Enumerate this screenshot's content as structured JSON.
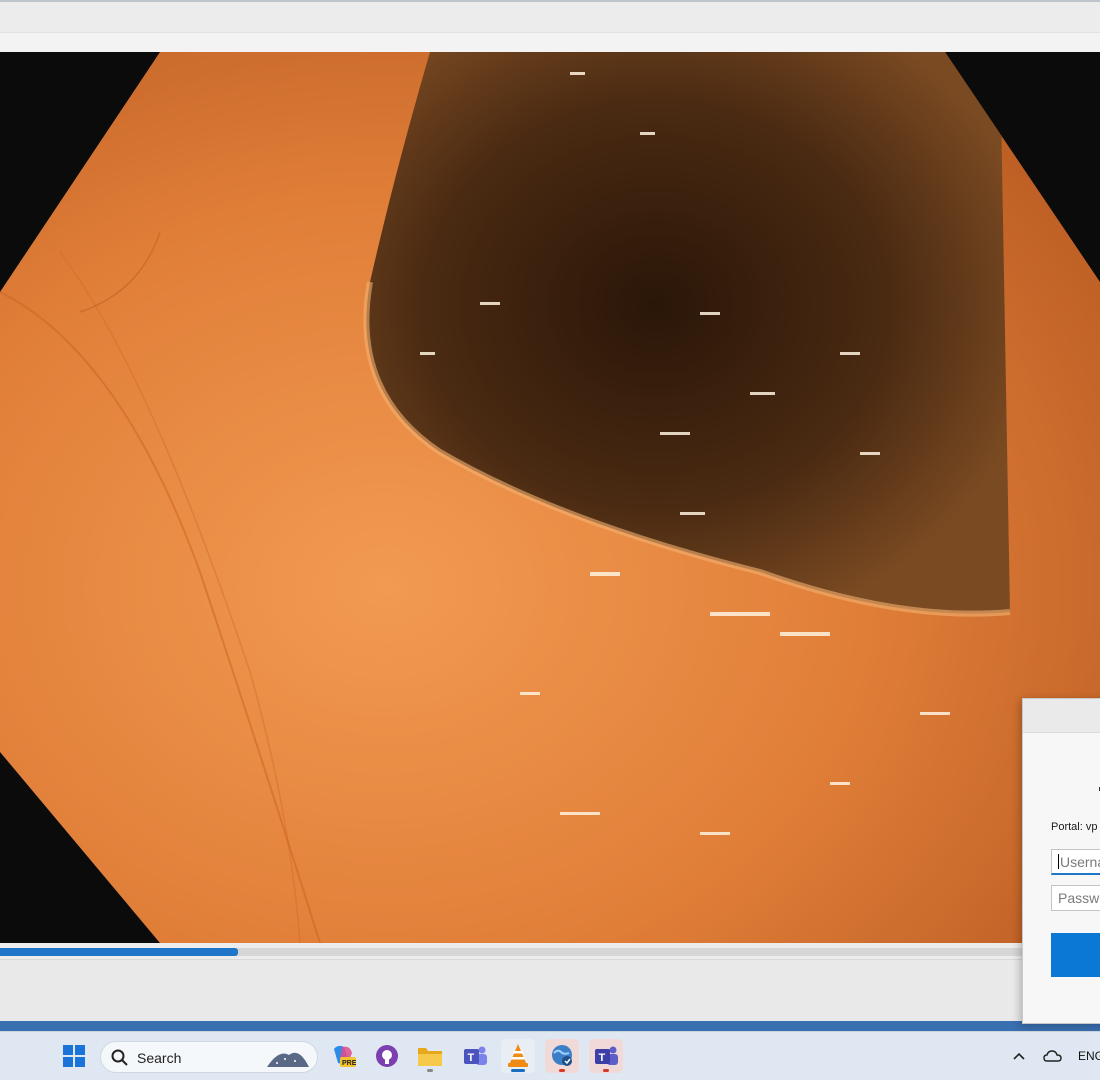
{
  "player": {
    "progress_fraction": 0.216
  },
  "vpn_dialog": {
    "portal_label": "Portal: vp",
    "username_placeholder": "Userna",
    "password_placeholder": "Passwo"
  },
  "taskbar": {
    "search_label": "Search",
    "tray_language": "ENG"
  },
  "colors": {
    "accent": "#1f76c9",
    "taskbar": "#dfe8f2"
  },
  "icons": [
    "windows-start-icon",
    "search-icon",
    "copilot-pre-icon",
    "github-desktop-icon",
    "file-explorer-icon",
    "teams-icon",
    "vlc-icon",
    "browser-icon",
    "teams-new-icon",
    "chevron-up-icon",
    "onedrive-icon"
  ]
}
